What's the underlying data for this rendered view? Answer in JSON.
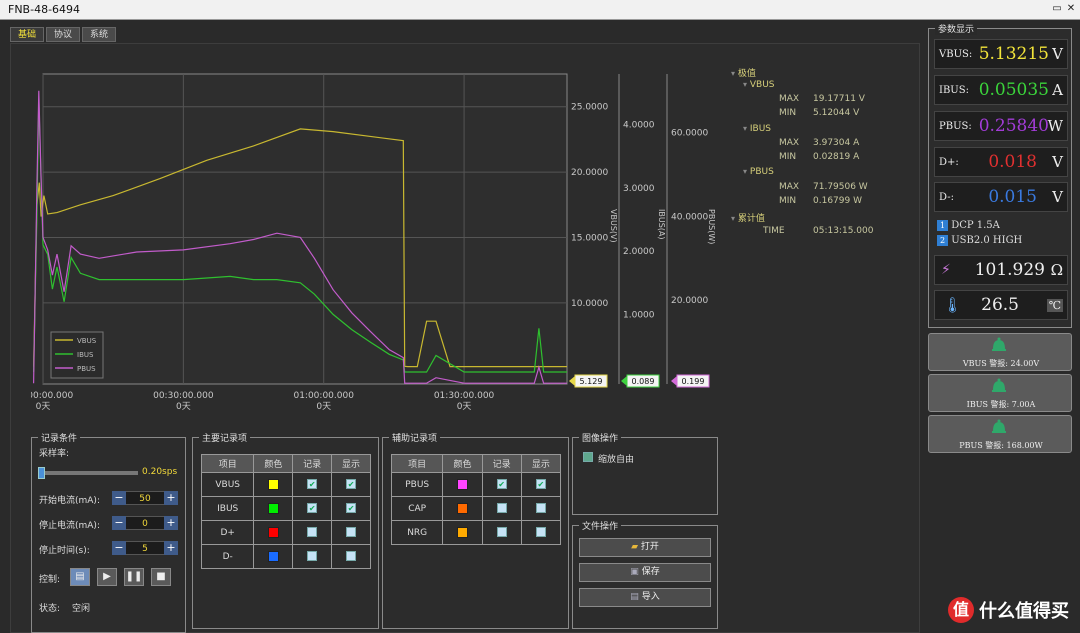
{
  "window": {
    "title": "FNB-48-6494",
    "restore_glyph": "▭",
    "close_glyph": "✕"
  },
  "tabs": [
    "基础",
    "协议",
    "系统"
  ],
  "chart_data": {
    "type": "line",
    "x_ticks": [
      {
        "time": "00:00:00.000",
        "day": "0天"
      },
      {
        "time": "00:30:00.000",
        "day": "0天"
      },
      {
        "time": "01:00:00.000",
        "day": "0天"
      },
      {
        "time": "01:30:00.000",
        "day": "0天"
      }
    ],
    "axes": [
      {
        "label": "VBUS(V)",
        "ticks": [
          "25.0000",
          "20.0000",
          "15.0000",
          "10.0000"
        ],
        "range": [
          3.8,
          27.5
        ],
        "marker": "5.129",
        "color": "#e6d84a"
      },
      {
        "label": "IBUS(A)",
        "ticks": [
          "4.0000",
          "3.0000",
          "2.0000",
          "1.0000"
        ],
        "range": [
          -0.1,
          4.8
        ],
        "marker": "0.089",
        "color": "#3fd23f"
      },
      {
        "label": "PBUS(W)",
        "ticks": [
          "60.0000",
          "40.0000",
          "20.0000"
        ],
        "range": [
          0,
          74
        ],
        "marker": "0.199",
        "color": "#d26ad8"
      }
    ],
    "x_range_min": [
      0,
      112
    ],
    "series": [
      {
        "name": "VBUS",
        "color": "#c8b830",
        "x": [
          -2,
          -1.3,
          -0.8,
          -0.4,
          0.2,
          1,
          3,
          8,
          15,
          25,
          35,
          45,
          55,
          62,
          77,
          77.3,
          78,
          80,
          82,
          84,
          87,
          90,
          100,
          112
        ],
        "y": [
          5.13,
          17.5,
          19.2,
          16.6,
          18.2,
          16.8,
          16.9,
          17.5,
          18.2,
          19.5,
          20.9,
          22,
          23.3,
          23.1,
          22.4,
          5.15,
          5.13,
          5.13,
          8.6,
          8.6,
          5.13,
          5.13,
          5.13,
          5.13
        ]
      },
      {
        "name": "IBUS",
        "color": "#2fc02f",
        "x": [
          -2,
          -1.3,
          -0.9,
          -0.4,
          0,
          1,
          2,
          3,
          4.5,
          6,
          8,
          12,
          20,
          30,
          40,
          45,
          50,
          55,
          58,
          62,
          66,
          70,
          74,
          77,
          77.3,
          82,
          84,
          90,
          100,
          105,
          106,
          107,
          112
        ],
        "y": [
          0.09,
          2.55,
          4.4,
          3.1,
          2.1,
          1.95,
          1.4,
          1.75,
          1.2,
          1.9,
          1.65,
          1.55,
          1.55,
          1.55,
          1.6,
          1.55,
          1.55,
          1.5,
          1.32,
          1.0,
          0.76,
          0.56,
          0.37,
          0.28,
          0.09,
          0.09,
          0.35,
          0.09,
          0.09,
          0.09,
          0.78,
          0.09,
          0.09
        ]
      },
      {
        "name": "PBUS",
        "color": "#c25ccb",
        "x": [
          -2,
          -1.3,
          -0.9,
          -0.4,
          0,
          1,
          2,
          3,
          4.5,
          6,
          8,
          12,
          20,
          30,
          40,
          45,
          50,
          55,
          58,
          62,
          66,
          70,
          74,
          77,
          77.3,
          82,
          84,
          90,
          100,
          105,
          106,
          107,
          112
        ],
        "y": [
          0.2,
          47,
          70,
          49,
          35,
          32,
          26,
          31,
          22,
          33,
          31,
          30,
          31.5,
          32,
          33.5,
          34.5,
          36,
          35,
          30,
          22.5,
          17,
          12.5,
          8.2,
          6.3,
          0.2,
          0.2,
          1.5,
          0.2,
          0.2,
          0.2,
          4,
          0.2,
          0.2
        ]
      }
    ],
    "legend": [
      "VBUS",
      "IBUS",
      "PBUS"
    ],
    "legend_placement": "bottom-left",
    "grid": true
  },
  "extremes": {
    "root": "极值",
    "vbus": {
      "label": "VBUS",
      "max_k": "MAX",
      "max": "19.17711 V",
      "min_k": "MIN",
      "min": "5.12044 V"
    },
    "ibus": {
      "label": "IBUS",
      "max_k": "MAX",
      "max": "3.97304 A",
      "min_k": "MIN",
      "min": "0.02819 A"
    },
    "pbus": {
      "label": "PBUS",
      "max_k": "MAX",
      "max": "71.79506 W",
      "min_k": "MIN",
      "min": "0.16799 W"
    },
    "accum": "累计值",
    "time_k": "TIME",
    "time": "05:13:15.000"
  },
  "record_cond": {
    "title": "记录条件",
    "rate_label": "采样率:",
    "rate_value": "0.20sps",
    "start_label": "开始电流(mA):",
    "start_value": "50",
    "stop_label": "停止电流(mA):",
    "stop_value": "0",
    "stoptime_label": "停止时间(s):",
    "stoptime_value": "5",
    "control_label": "控制:",
    "state_label": "状态:",
    "state_value": "空闲"
  },
  "main_rec": {
    "title": "主要记录项",
    "headers": [
      "项目",
      "颜色",
      "记录",
      "显示"
    ],
    "rows": [
      {
        "name": "VBUS",
        "color": "#ffff00",
        "rec": true,
        "show": true
      },
      {
        "name": "IBUS",
        "color": "#00ee00",
        "rec": true,
        "show": true
      },
      {
        "name": "D+",
        "color": "#ff0000",
        "rec": false,
        "show": false
      },
      {
        "name": "D-",
        "color": "#1a6cff",
        "rec": false,
        "show": false
      }
    ]
  },
  "aux_rec": {
    "title": "辅助记录项",
    "headers": [
      "项目",
      "颜色",
      "记录",
      "显示"
    ],
    "rows": [
      {
        "name": "PBUS",
        "color": "#ff44ff",
        "rec": true,
        "show": true
      },
      {
        "name": "CAP",
        "color": "#ff6a00",
        "rec": false,
        "show": false
      },
      {
        "name": "NRG",
        "color": "#ffaa00",
        "rec": false,
        "show": false
      }
    ]
  },
  "image_ops": {
    "title": "图像操作",
    "auto_zoom": "缩放自由"
  },
  "file_ops": {
    "title": "文件操作",
    "open": "打开",
    "save": "保存",
    "import": "导入"
  },
  "params": {
    "title": "参数显示",
    "vbus": {
      "name": "VBUS:",
      "value": "5.13215",
      "unit": "V",
      "color": "#f2e43a"
    },
    "ibus": {
      "name": "IBUS:",
      "value": "0.05035",
      "unit": "A",
      "color": "#3bd43b"
    },
    "pbus": {
      "name": "PBUS:",
      "value": "0.25840",
      "unit": "W",
      "color": "#a23cd6"
    },
    "dp": {
      "name": "D+:",
      "value": "0.018",
      "unit": "V",
      "color": "#e03030"
    },
    "dm": {
      "name": "D-:",
      "value": "0.015",
      "unit": "V",
      "color": "#3a7ae0"
    },
    "proto1": "DCP 1.5A",
    "proto2": "USB2.0 HIGH",
    "resistance": "101.929",
    "res_unit": "Ω",
    "temperature": "26.5",
    "temp_unit": "℃"
  },
  "alarms": [
    "VBUS 警报: 24.00V",
    "IBUS 警报: 7.00A",
    "PBUS 警报: 168.00W"
  ],
  "watermark": {
    "logo": "值",
    "text": "什么值得买"
  }
}
